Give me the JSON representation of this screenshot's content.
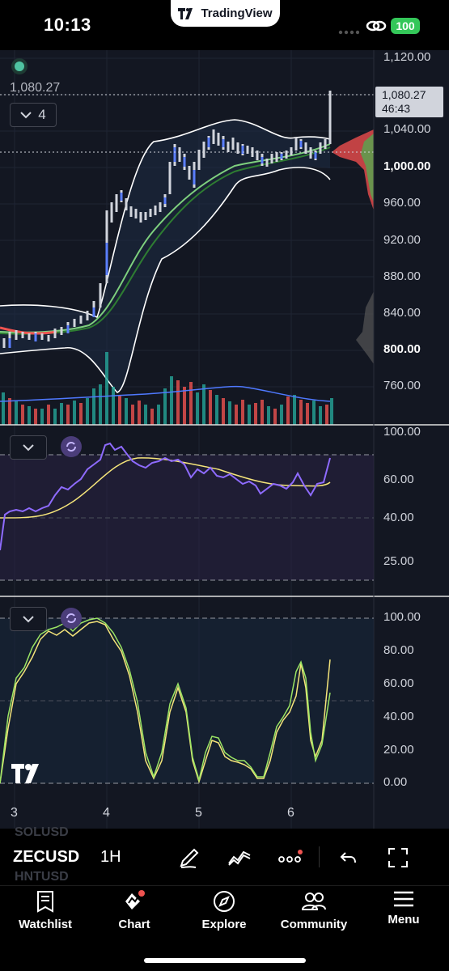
{
  "status_bar": {
    "time": "10:13",
    "app_badge": "TradingView",
    "battery": "100",
    "accent_battery": "#34c759"
  },
  "chart": {
    "symbol": "ZECUSD",
    "interval": "1H",
    "last_price": "1,080.27",
    "last_price_tag": "1,080.27",
    "countdown": "46:43",
    "indicator_count": "4",
    "colors": {
      "background": "#131722",
      "bull_candle": "#5b7fff",
      "bear_candle": "#d1d4dc",
      "bollinger": "#ffffff",
      "ema_fast": "#4caf50",
      "ema_slow": "#2e7d32",
      "rsi_line": "#8e6bff",
      "rsi_ma": "#f5e57a",
      "stoch_k": "#9be564",
      "stoch_d": "#f5e57a",
      "volume_up": "#26a69a",
      "volume_down": "#ef5350"
    },
    "price_axis": [
      "1,120.00",
      "1,040.00",
      "1,000.00",
      "960.00",
      "920.00",
      "880.00",
      "840.00",
      "800.00",
      "760.00"
    ],
    "rsi_axis": [
      "100.00",
      "60.00",
      "40.00",
      "25.00"
    ],
    "stoch_axis": [
      "100.00",
      "80.00",
      "60.00",
      "40.00",
      "20.00",
      "0.00"
    ],
    "date_axis": [
      "3",
      "4",
      "5",
      "6"
    ],
    "ghost_tickers": [
      "SOLUSD",
      "HNTUSD"
    ]
  },
  "toolbar": {
    "draw_icon": "pen-icon",
    "indicator_icon": "wave-icon",
    "more_icon": "more-dots-icon",
    "undo_icon": "undo-icon",
    "fullscreen_icon": "fullscreen-icon"
  },
  "tabs": [
    {
      "label": "Watchlist",
      "icon": "book-icon"
    },
    {
      "label": "Chart",
      "icon": "chart-icon"
    },
    {
      "label": "Explore",
      "icon": "compass-icon"
    },
    {
      "label": "Community",
      "icon": "people-icon"
    },
    {
      "label": "Menu",
      "icon": "hamburger-icon"
    }
  ]
}
